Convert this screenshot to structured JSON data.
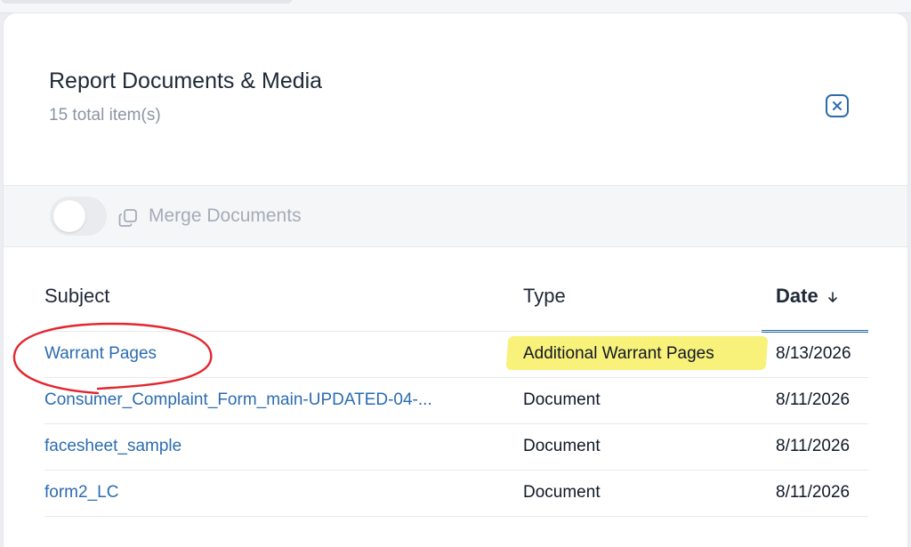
{
  "modal": {
    "title": "Report Documents & Media",
    "subtitle": "15 total item(s)"
  },
  "toolbar": {
    "merge_label": "Merge Documents",
    "merge_toggle_on": false
  },
  "table": {
    "columns": {
      "subject": "Subject",
      "type": "Type",
      "date": "Date"
    },
    "sort": {
      "column": "date",
      "direction": "desc"
    },
    "rows": [
      {
        "subject": "Warrant Pages",
        "type": "Additional Warrant Pages",
        "date": "8/13/2026"
      },
      {
        "subject": "Consumer_Complaint_Form_main-UPDATED-04-...",
        "type": "Document",
        "date": "8/11/2026"
      },
      {
        "subject": "facesheet_sample",
        "type": "Document",
        "date": "8/11/2026"
      },
      {
        "subject": "form2_LC",
        "type": "Document",
        "date": "8/11/2026"
      }
    ]
  },
  "colors": {
    "link": "#2b6cb0",
    "highlight": "#f8f17a",
    "annotation": "#e3262d"
  }
}
